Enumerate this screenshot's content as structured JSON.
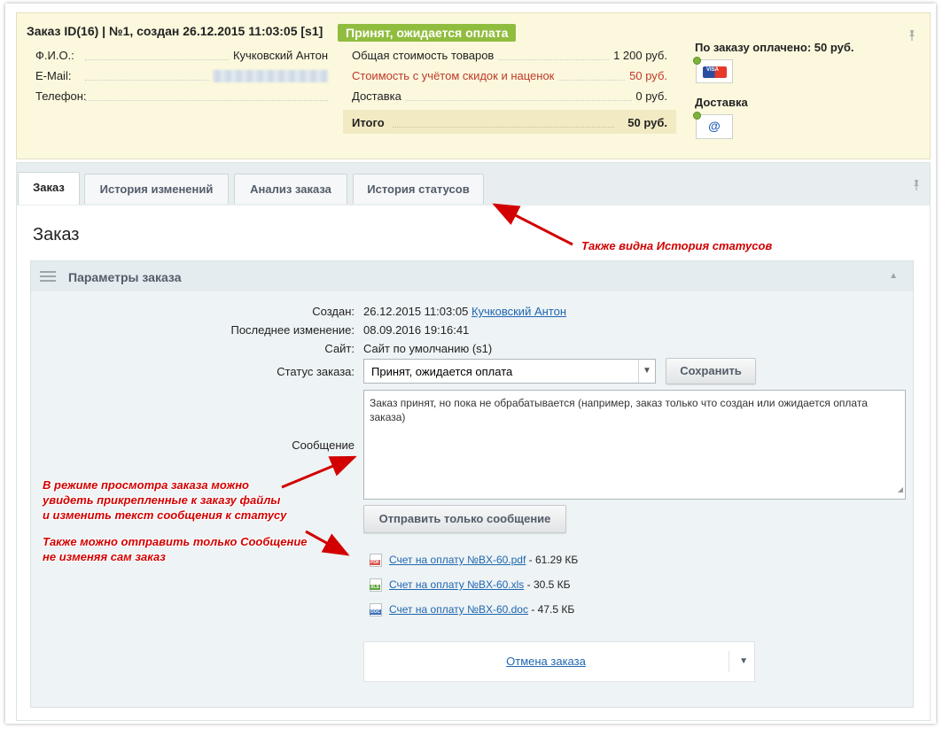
{
  "header": {
    "order_title": "Заказ ID(16) | №1, создан 26.12.2015 11:03:05 [s1]",
    "status_badge": "Принят, ожидается оплата",
    "customer": [
      {
        "label": "Ф.И.О.:",
        "value": "Кучковский Антон"
      },
      {
        "label": "E-Mail:",
        "value": ""
      },
      {
        "label": "Телефон:",
        "value": ""
      }
    ],
    "costs": [
      {
        "label": "Общая стоимость товаров",
        "value": "1 200 руб."
      },
      {
        "label": "Стоимость с учётом скидок и наценок",
        "value": "50 руб."
      },
      {
        "label": "Доставка",
        "value": "0 руб."
      }
    ],
    "total": {
      "label": "Итого",
      "value": "50 руб."
    },
    "paid_label": "По заказу оплачено: 50 руб.",
    "delivery_label": "Доставка",
    "payment_icon": "credit-card-icon",
    "delivery_icon": "email-at-icon",
    "badge_color": "#91bd3e"
  },
  "tabs": [
    {
      "label": "Заказ",
      "active": true
    },
    {
      "label": "История изменений",
      "active": false
    },
    {
      "label": "Анализ заказа",
      "active": false
    },
    {
      "label": "История статусов",
      "active": false
    }
  ],
  "main": {
    "page_title": "Заказ",
    "params_title": "Параметры заказа",
    "fields": {
      "created_label": "Создан:",
      "created_value": "26.12.2015 11:03:05",
      "created_user": "Кучковский Антон",
      "modified_label": "Последнее изменение:",
      "modified_value": "08.09.2016 19:16:41",
      "site_label": "Сайт:",
      "site_value": "Сайт по умолчанию (s1)",
      "status_label": "Статус заказа:",
      "status_value": "Принят, ожидается оплата",
      "save_button": "Сохранить",
      "message_label": "Сообщение",
      "message_text": "Заказ принят, но пока не обрабатывается (например, заказ только что создан или ожидается оплата заказа)",
      "send_message_button": "Отправить только сообщение"
    },
    "files": [
      {
        "name": "Счет на оплату №BX-60.pdf",
        "size": "- 61.29 КБ",
        "type": "PDF",
        "color": "#d9534f"
      },
      {
        "name": "Счет на оплату №BX-60.xls",
        "size": "- 30.5 КБ",
        "type": "XLS",
        "color": "#5ea33b"
      },
      {
        "name": "Счет на оплату №BX-60.doc",
        "size": "- 47.5 КБ",
        "type": "DOC",
        "color": "#3a6fb5"
      }
    ],
    "cancel_link": "Отмена заказа"
  },
  "annotations": {
    "status_history": "Также видна История статусов",
    "files_note_1": "В режиме просмотра заказа можно",
    "files_note_2": "увидеть прикрепленные к заказу файлы",
    "files_note_3": "и изменить текст сообщения к статусу",
    "message_note_1": "Также можно отправить только Сообщение",
    "message_note_2": "не изменяя сам заказ",
    "color": "#d20000"
  }
}
